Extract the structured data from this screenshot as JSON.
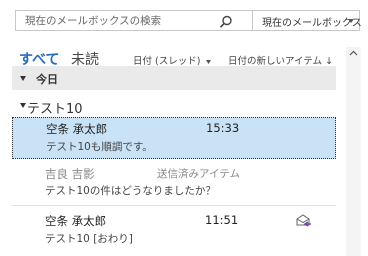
{
  "search": {
    "placeholder": "現在のメールボックスの検索",
    "scope": "現在のメールボックス"
  },
  "filters": {
    "all_label": "すべて",
    "unread_label": "未読",
    "sort_label": "日付 (スレッド)",
    "order_label": "日付の新しいアイテム ↓"
  },
  "groups": {
    "today_label": "今日"
  },
  "conversation": {
    "title": "テスト10"
  },
  "messages": [
    {
      "sender": "空条 承太郎",
      "time": "15:33",
      "preview": "テスト10も順調です。",
      "selected": true
    },
    {
      "sender": "吉良 吉影",
      "folder": "送信済みアイテム",
      "preview": "テスト10の件はどうなりましたか？"
    },
    {
      "sender": "空条 承太郎",
      "time": "11:51",
      "preview": "テスト10 [おわり]",
      "icon": "replied-envelope-icon"
    }
  ],
  "colors": {
    "accent": "#2a6ebb",
    "selection": "#c9e2f5",
    "group_header": "#eaeaea",
    "reply_arrow": "#7a3fa0"
  }
}
